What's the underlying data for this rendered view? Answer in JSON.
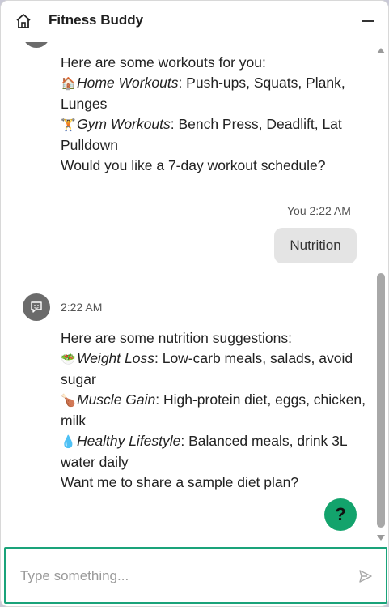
{
  "header": {
    "title": "Fitness Buddy",
    "home_icon": "home-icon",
    "minimize_icon": "minimize-icon"
  },
  "messages": [
    {
      "sender": "bot",
      "lines": [
        {
          "text": "Here are some workouts for you:"
        },
        {
          "emoji": "🏠",
          "label": "Home Workouts",
          "rest": ": Push-ups, Squats, Plank, Lunges"
        },
        {
          "emoji": "🏋",
          "label": "Gym Workouts",
          "rest": ": Bench Press, Deadlift, Lat Pulldown"
        },
        {
          "text": "Would you like a 7-day workout schedule?"
        }
      ]
    },
    {
      "sender": "user",
      "time": "You 2:22 AM",
      "text": "Nutrition"
    },
    {
      "sender": "bot",
      "time": "2:22 AM",
      "lines": [
        {
          "text": "Here are some nutrition suggestions:"
        },
        {
          "emoji": "🥗",
          "label": "Weight Loss",
          "rest": ": Low-carb meals, salads, avoid sugar"
        },
        {
          "emoji": "🍗",
          "label": "Muscle Gain",
          "rest": ": High-protein diet, eggs, chicken, milk"
        },
        {
          "emoji": "💧",
          "label": "Healthy Lifestyle",
          "rest": ": Balanced meals, drink 3L water daily"
        },
        {
          "text": "Want me to share a sample diet plan?"
        }
      ]
    }
  ],
  "help_button": {
    "label": "?"
  },
  "composer": {
    "placeholder": "Type something...",
    "value": "",
    "send_icon": "send-icon"
  },
  "colors": {
    "accent": "#13a36c",
    "composer_border": "#1aa37a",
    "avatar": "#6b6b6b",
    "user_bubble": "#e4e4e4"
  }
}
